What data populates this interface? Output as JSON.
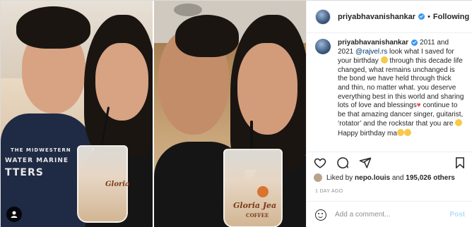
{
  "header": {
    "username": "priyabhavanishankar",
    "separator": "•",
    "follow_state": "Following"
  },
  "caption": {
    "username": "priyabhavanishankar",
    "text_part1": "2011 and 2021",
    "mention": "@rajvel.rs",
    "text_part2": "look what I saved for your birthday",
    "text_part3": "through this decade life changed, what remains unchanged is the bond we have held through thick and thin, no matter what. you deserve everything best in this world and sharing lots of love and blessings",
    "text_part4": "continue to be that amazing dancer singer, guitarist, ‘rotator’ and the rockstar that you are",
    "text_part5": "Happy birthday ma"
  },
  "photo": {
    "shirt_text_line1": "THE MIDWESTERN",
    "shirt_text_line2": "WATER MARINE",
    "shirt_text_line3": "TTERS",
    "cup_left_label": "Gloria",
    "cup_right_label": "Gloria Jea",
    "cup_right_sub": "COFFEE"
  },
  "likes": {
    "prefix": "Liked by",
    "user": "nepo.louis",
    "and": "and",
    "count": "195,026 others"
  },
  "date": "1 DAY AGO",
  "comment_box": {
    "placeholder": "Add a comment...",
    "post_label": "Post"
  },
  "colors": {
    "link": "#00376b",
    "verified": "#3897f0",
    "post_disabled": "#b2dffc",
    "heart": "#ed4956"
  }
}
